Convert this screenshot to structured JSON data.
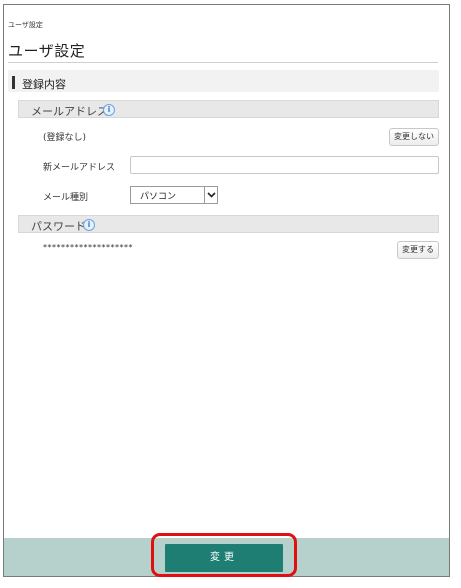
{
  "breadcrumb": "ユーザ設定",
  "page_title": "ユーザ設定",
  "section": {
    "label": "登録内容"
  },
  "email_group": {
    "label": "メールアドレス",
    "info_icon": "i",
    "current_value": "(登録なし)",
    "no_change_button": "変更しない",
    "new_email_label": "新メールアドレス",
    "new_email_value": "",
    "mail_type_label": "メール種別",
    "mail_type_selected": "パソコン"
  },
  "password_group": {
    "label": "パスワード",
    "info_icon": "i",
    "masked_value": "********************",
    "change_button": "変更する"
  },
  "footer": {
    "submit_label": "変更"
  },
  "colors": {
    "accent": "#1e7e73",
    "footer_bg": "#b6d0cc",
    "highlight": "#e01010",
    "info": "#3a83d2"
  }
}
